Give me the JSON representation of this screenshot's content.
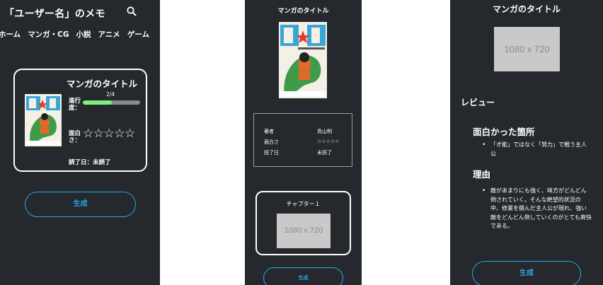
{
  "screen1": {
    "title": "「ユーザー名」のメモ",
    "nav": [
      "ホーム",
      "マンガ・CG",
      "小説",
      "アニメ",
      "ゲーム"
    ],
    "card": {
      "title": "マンガのタイトル",
      "progress_label": "進行度：",
      "progress_count": "2/4",
      "progress_value": 0.5,
      "fun_label": "面白さ：",
      "stars": "☆☆☆☆☆",
      "read_date": "読了日：未読了"
    },
    "generate_label": "生成"
  },
  "screen2": {
    "title": "マンガのタイトル",
    "info": [
      {
        "label": "著者",
        "value": "鳥山明"
      },
      {
        "label": "面白さ",
        "value": "☆☆☆☆☆"
      },
      {
        "label": "読了日",
        "value": "未読了"
      }
    ],
    "chapter_title": "チャプター１",
    "placeholder": "1080 x 720",
    "generate_label": "生成"
  },
  "screen3": {
    "title": "マンガのタイトル",
    "placeholder": "1080 x 720",
    "review_heading": "レビュー",
    "sections": [
      {
        "heading": "面白かった箇所",
        "bullet": "「才能」ではなく「努力」で戦う主人公"
      },
      {
        "heading": "理由",
        "bullet": "敵があまりにも強く、味方がどんどん倒されていく。そんな絶望的状況の中、修業を積んだ主人公が現れ、強い敵をどんどん倒していくのがとても爽快である。"
      }
    ],
    "generate_label": "生成"
  },
  "colors": {
    "background": "#25282c",
    "accent": "#2aa6e6",
    "progress_fill": "#7cf07c",
    "placeholder_bg": "#c9c9c9"
  }
}
